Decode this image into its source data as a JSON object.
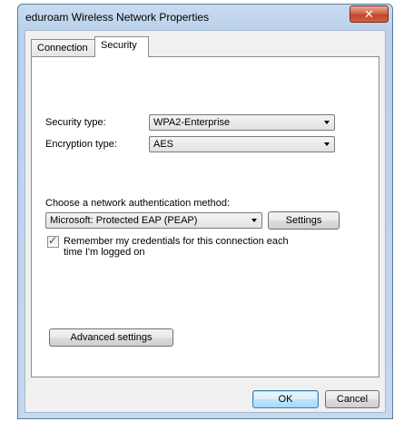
{
  "window": {
    "title": "eduroam Wireless Network Properties",
    "close_glyph": "✕"
  },
  "tabs": [
    {
      "label": "Connection",
      "selected": false
    },
    {
      "label": "Security",
      "selected": true
    }
  ],
  "security": {
    "security_type_label": "Security type:",
    "security_type_value": "WPA2-Enterprise",
    "encryption_type_label": "Encryption type:",
    "encryption_type_value": "AES",
    "auth_method_label": "Choose a network authentication method:",
    "auth_method_value": "Microsoft: Protected EAP (PEAP)",
    "settings_button": "Settings",
    "remember_checked": true,
    "remember_line1": "Remember my credentials for this connection each",
    "remember_line2": "time I'm logged on",
    "advanced_button": "Advanced settings"
  },
  "footer": {
    "ok_button": "OK",
    "cancel_button": "Cancel"
  },
  "icons": {
    "close": "close-icon",
    "dropdown": "chevron-down-icon",
    "check": "checkmark-icon"
  },
  "colors": {
    "title_gradient": "#b9d1ea",
    "close_button": "#c4452a",
    "default_button_border": "#3c7fb1"
  }
}
